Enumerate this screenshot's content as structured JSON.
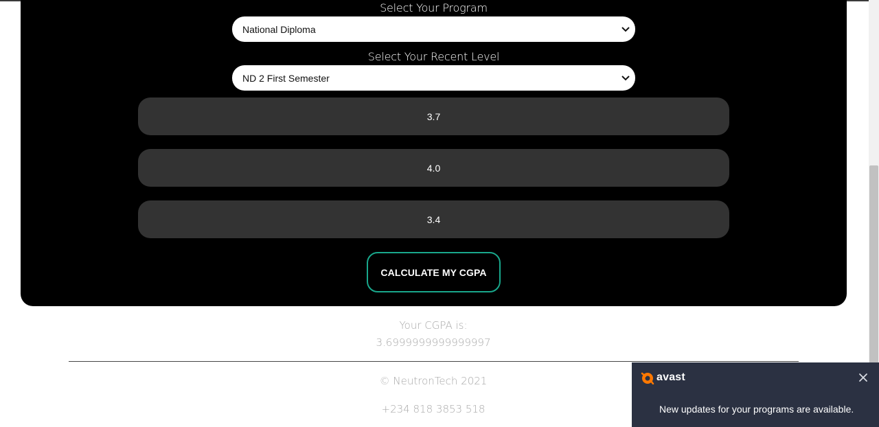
{
  "form": {
    "program_label": "Select Your Program",
    "program_selected": "National Diploma",
    "level_label": "Select Your Recent Level",
    "level_selected": "ND 2 First Semester",
    "gpa_inputs": [
      "3.7",
      "4.0",
      "3.4"
    ],
    "calculate_label": "CALCULATE MY CGPA"
  },
  "result": {
    "label": "Your CGPA is:",
    "value": "3.6999999999999997"
  },
  "footer": {
    "copyright": "© NeutronTech 2021",
    "phone": "+234 818 3853 518"
  },
  "notification": {
    "brand": "avast",
    "message": "New updates for your programs are available.",
    "close_icon": "close-icon",
    "brand_color": "#ff7800",
    "background": "#2b3142"
  },
  "colors": {
    "panel": "#000000",
    "input_bg": "#333333",
    "button_border": "#19a88c"
  }
}
